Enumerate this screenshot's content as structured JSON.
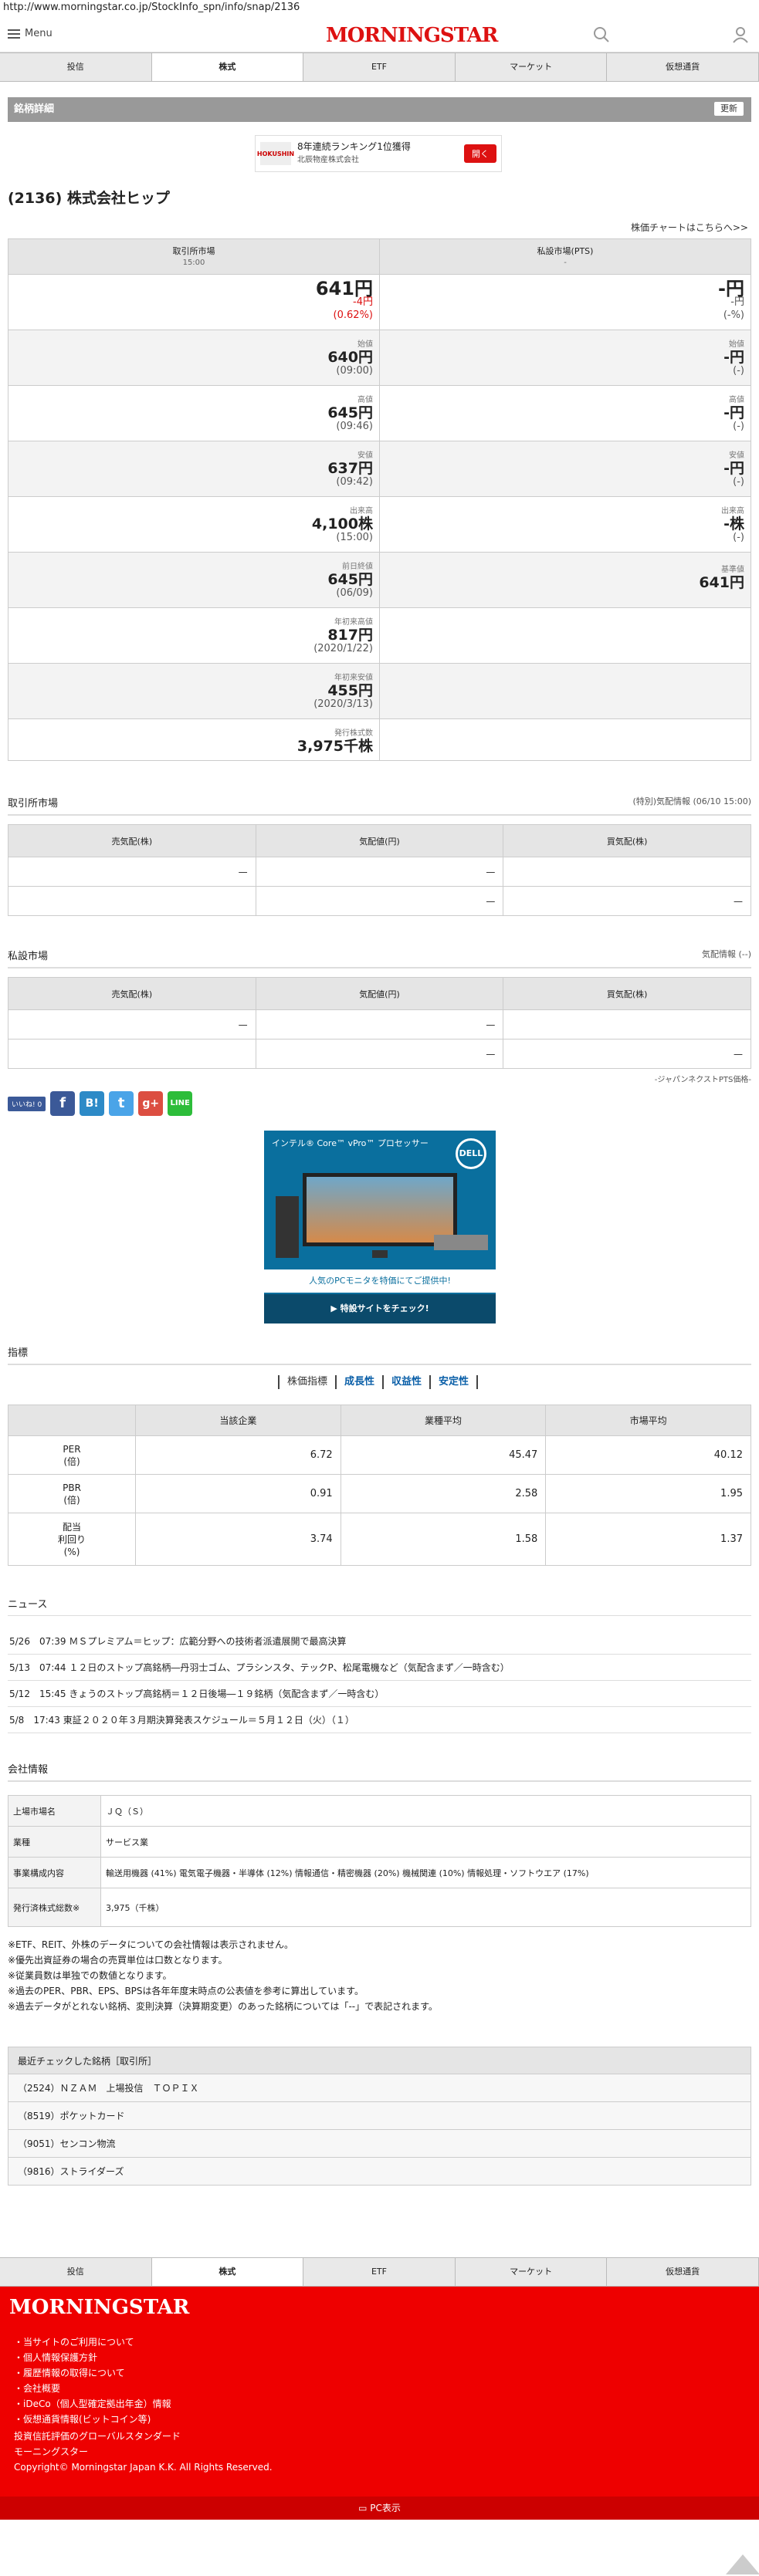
{
  "url": "http://www.morningstar.co.jp/StockInfo_spn/info/snap/2136",
  "header": {
    "menu": "Menu",
    "logo": "MORNINGSTAR"
  },
  "tabs": [
    "投信",
    "株式",
    "ETF",
    "マーケット",
    "仮想通貨"
  ],
  "active_tab": "株式",
  "section_bar": {
    "title": "銘柄詳細",
    "update": "更新"
  },
  "ad1": {
    "logo": "HOKUSHIN",
    "title": "8年連続ランキング1位獲得",
    "company": "北辰物産株式会社",
    "button": "開く"
  },
  "stock_title": "(2136) 株式会社ヒップ",
  "chart_link": "株価チャートはこちらへ>>",
  "price_table": {
    "head_left": {
      "title": "取引所市場",
      "sub": "15:00"
    },
    "head_right": {
      "title": "私設市場(PTS)",
      "sub": "-"
    },
    "rows": [
      {
        "l_label": "",
        "l_val": "641円",
        "l_sub1": "-4円",
        "l_sub2": "(0.62%)",
        "r_label": "",
        "r_val": "-円",
        "r_sub1": "-円",
        "r_sub2": "(-%)"
      },
      {
        "l_label": "始値",
        "l_val": "640円",
        "l_sub1": "(09:00)",
        "r_label": "始値",
        "r_val": "-円",
        "r_sub1": "(-)"
      },
      {
        "l_label": "高値",
        "l_val": "645円",
        "l_sub1": "(09:46)",
        "r_label": "高値",
        "r_val": "-円",
        "r_sub1": "(-)"
      },
      {
        "l_label": "安値",
        "l_val": "637円",
        "l_sub1": "(09:42)",
        "r_label": "安値",
        "r_val": "-円",
        "r_sub1": "(-)"
      },
      {
        "l_label": "出来高",
        "l_val": "4,100株",
        "l_sub1": "(15:00)",
        "r_label": "出来高",
        "r_val": "-株",
        "r_sub1": "(-)"
      },
      {
        "l_label": "前日終値",
        "l_val": "645円",
        "l_sub1": "(06/09)",
        "r_label": "基準値",
        "r_val": "641円",
        "r_sub1": ""
      },
      {
        "l_label": "年初来高値",
        "l_val": "817円",
        "l_sub1": "(2020/1/22)"
      },
      {
        "l_label": "年初来安値",
        "l_val": "455円",
        "l_sub1": "(2020/3/13)"
      },
      {
        "l_label": "発行株式数",
        "l_val": "3,975千株",
        "l_sub1": ""
      }
    ]
  },
  "exchange": {
    "title": "取引所市場",
    "right": "(特別)気配情報 (06/10 15:00)",
    "cols": [
      "売気配(株)",
      "気配値(円)",
      "買気配(株)"
    ],
    "rows": [
      [
        "—",
        "—",
        ""
      ],
      [
        "",
        "—",
        "—"
      ]
    ]
  },
  "private": {
    "title": "私設市場",
    "right": "気配情報 (--)",
    "cols": [
      "売気配(株)",
      "気配値(円)",
      "買気配(株)"
    ],
    "rows": [
      [
        "—",
        "—",
        ""
      ],
      [
        "",
        "—",
        "—"
      ]
    ],
    "note": "-ジャパンネクストPTS価格-"
  },
  "social": {
    "like": "いいね! 0"
  },
  "ad2": {
    "top": "インテル® Core™ vPro™ プロセッサー",
    "brand": "DELL",
    "msg": "人気のPCモニタを特価にてご提供中!",
    "cta": "▶ 特設サイトをチェック!"
  },
  "indicators": {
    "title": "指標",
    "tabs": [
      "株価指標",
      "成長性",
      "収益性",
      "安定性"
    ],
    "cols": [
      "",
      "当該企業",
      "業種平均",
      "市場平均"
    ],
    "rows": [
      {
        "name": "PER\n(倍)",
        "v": [
          "6.72",
          "45.47",
          "40.12"
        ]
      },
      {
        "name": "PBR\n(倍)",
        "v": [
          "0.91",
          "2.58",
          "1.95"
        ]
      },
      {
        "name": "配当\n利回り\n(%)",
        "v": [
          "3.74",
          "1.58",
          "1.37"
        ]
      }
    ]
  },
  "news": {
    "title": "ニュース",
    "items": [
      "5/26　07:39 ＭＳプレミアム＝ヒップ：広範分野への技術者派遣展開で最高決算",
      "5/13　07:44 １２日のストップ高銘柄―丹羽士ゴム、プラシンスタ、テックP、松尾電機など（気配含まず／一時含む）",
      "5/12　15:45 きょうのストップ高銘柄＝１２日後場―１９銘柄（気配含まず／一時含む）",
      "5/8　17:43 東証２０２０年３月期決算発表スケジュール＝５月１２日（火）（１）"
    ]
  },
  "company": {
    "title": "会社情報",
    "rows": [
      {
        "k": "上場市場名",
        "v": "ＪＱ（Ｓ）"
      },
      {
        "k": "業種",
        "v": "サービス業"
      },
      {
        "k": "事業構成内容",
        "v": "輸送用機器 (41%) 電気電子機器・半導体 (12%) 情報通信・精密機器 (20%) 機械関連 (10%) 情報処理・ソフトウエア (17%)"
      },
      {
        "k": "発行済株式総数※",
        "v": "3,975（千株）"
      }
    ]
  },
  "notes": [
    "※ETF、REIT、外株のデータについての会社情報は表示されません。",
    "※優先出資証券の場合の売買単位は口数となります。",
    "※従業員数は単独での数値となります。",
    "※過去のPER、PBR、EPS、BPSは各年年度末時点の公表値を参考に算出しています。",
    "※過去データがとれない銘柄、変則決算（決算期変更）のあった銘柄については「--」で表記されます。"
  ],
  "recent": {
    "title": "最近チェックした銘柄［取引所］",
    "items": [
      "（2524）ＮＺＡＭ　上場投信　ＴＯＰＩＸ",
      "（8519）ポケットカード",
      "（9051）センコン物流",
      "（9816）ストライダーズ"
    ]
  },
  "footer": {
    "logo": "MORNINGSTAR",
    "links": [
      "・当サイトのご利用について",
      "・個人情報保護方針",
      "・履歴情報の取得について",
      "・会社概要",
      "・iDeCo（個人型確定拠出年金）情報",
      "・仮想通貨情報(ビットコイン等)"
    ],
    "copy": [
      "投資信託評価のグローバルスタンダード",
      "モーニングスター",
      "Copyright© Morningstar Japan K.K. All Rights Reserved."
    ],
    "pc": "PC表示"
  }
}
